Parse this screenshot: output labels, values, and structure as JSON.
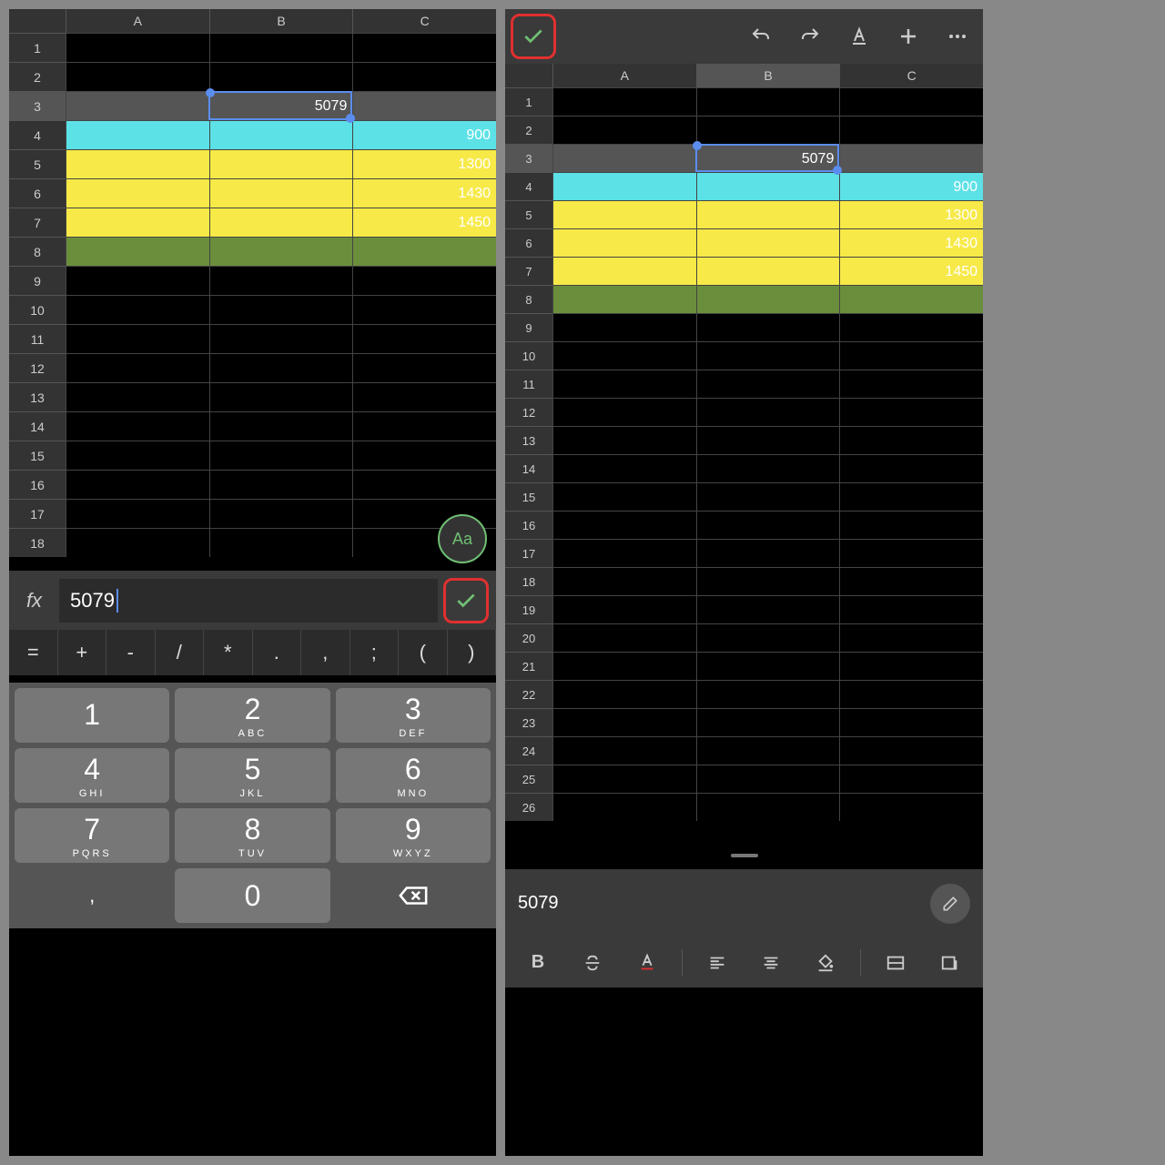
{
  "left": {
    "columns": [
      "A",
      "B",
      "C"
    ],
    "row_labels": [
      "1",
      "2",
      "3",
      "4",
      "5",
      "6",
      "7",
      "8",
      "9",
      "10",
      "11",
      "12",
      "13",
      "14",
      "15",
      "16",
      "17",
      "18"
    ],
    "selected_cell": "B3",
    "cells": {
      "B3": "5079",
      "C4": "900",
      "C5": "1300",
      "C6": "1430",
      "C7": "1450"
    },
    "formula_value": "5079",
    "operators": [
      "=",
      "+",
      "-",
      "/",
      "*",
      ".",
      ",",
      ";",
      "(",
      ")"
    ],
    "keypad": [
      [
        {
          "d": "1",
          "s": ""
        },
        {
          "d": "2",
          "s": "ABC"
        },
        {
          "d": "3",
          "s": "DEF"
        }
      ],
      [
        {
          "d": "4",
          "s": "GHI"
        },
        {
          "d": "5",
          "s": "JKL"
        },
        {
          "d": "6",
          "s": "MNO"
        }
      ],
      [
        {
          "d": "7",
          "s": "PQRS"
        },
        {
          "d": "8",
          "s": "TUV"
        },
        {
          "d": "9",
          "s": "WXYZ"
        }
      ]
    ],
    "keypad_bottom": {
      "comma": ",",
      "zero": "0"
    },
    "aa_label": "Aa"
  },
  "right": {
    "columns": [
      "A",
      "B",
      "C"
    ],
    "row_labels": [
      "1",
      "2",
      "3",
      "4",
      "5",
      "6",
      "7",
      "8",
      "9",
      "10",
      "11",
      "12",
      "13",
      "14",
      "15",
      "16",
      "17",
      "18",
      "19",
      "20",
      "21",
      "22",
      "23",
      "24",
      "25",
      "26"
    ],
    "selected_cell": "B3",
    "cells": {
      "B3": "5079",
      "C4": "900",
      "C5": "1300",
      "C6": "1430",
      "C7": "1450"
    },
    "formula_value": "5079"
  }
}
